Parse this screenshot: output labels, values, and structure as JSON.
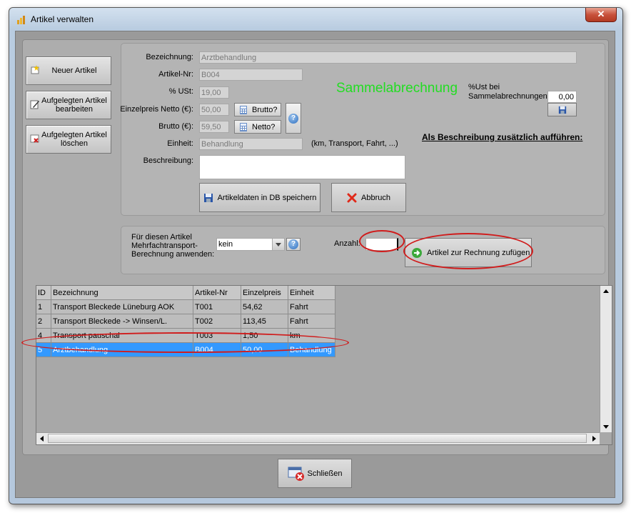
{
  "window": {
    "title": "Artikel verwalten",
    "close_label": "✕"
  },
  "left_buttons": {
    "new_article": "Neuer Artikel",
    "edit_article": "Aufgelegten Artikel bearbeiten",
    "delete_article": "Aufgelegten Artikel löschen"
  },
  "form": {
    "bezeichnung_label": "Bezeichnung:",
    "bezeichnung_value": "Arztbehandlung",
    "artikelnr_label": "Artikel-Nr:",
    "artikelnr_value": "B004",
    "ust_label": "% USt:",
    "ust_value": "19,00",
    "netto_label": "Einzelpreis Netto (€):",
    "netto_value": "50,00",
    "brutto_btn": "Brutto?",
    "brutto_label": "Brutto (€):",
    "brutto_value": "59,50",
    "netto_btn": "Netto?",
    "einheit_label": "Einheit:",
    "einheit_value": "Behandlung",
    "einheit_hint": "(km, Transport, Fahrt, ...)",
    "beschreibung_label": "Beschreibung:",
    "beschreibung_value": "",
    "sammel_title": "Sammelabrechnung",
    "sammel_ust_label": "%Ust bei Sammelabrechnungen",
    "sammel_ust_value": "0,00",
    "als_beschreibung": "Als Beschreibung zusätzlich aufführen:",
    "save_btn": "Artikeldaten in DB speichern",
    "cancel_btn": "Abbruch"
  },
  "multi": {
    "label": "Für diesen Artikel Mehrfachtransport-Berechnung anwenden:",
    "select_value": "kein",
    "anzahl_label": "Anzahl:",
    "anzahl_value": "",
    "add_btn": "Artikel zur Rechnung zufügen"
  },
  "table": {
    "columns": [
      "ID",
      "Bezeichnung",
      "Artikel-Nr",
      "Einzelpreis",
      "Einheit"
    ],
    "rows": [
      [
        "1",
        "Transport Bleckede Lüneburg AOK",
        "T001",
        "54,62",
        "Fahrt"
      ],
      [
        "2",
        "Transport Bleckede -> Winsen/L.",
        "T002",
        "113,45",
        "Fahrt"
      ],
      [
        "4",
        "Transport pauschal",
        "T003",
        "1,50",
        "km"
      ],
      [
        "5",
        "Arztbehandlung",
        "B004",
        "50,00",
        "Behandlung"
      ]
    ],
    "selected_row": 3
  },
  "footer": {
    "close_btn": "Schließen"
  },
  "colors": {
    "sammel_green": "#22dd22",
    "selection_blue": "#3399ff",
    "annotation_red": "#d01c1c"
  },
  "icons": [
    "app-icon",
    "new-article-icon",
    "edit-article-icon",
    "delete-article-icon",
    "calculator-icon",
    "help-icon",
    "save-icon",
    "cancel-x-icon",
    "add-arrow-icon",
    "close-window-icon",
    "dropdown-arrow-icon",
    "scroll-up-icon",
    "scroll-down-icon",
    "scroll-left-icon",
    "scroll-right-icon"
  ]
}
